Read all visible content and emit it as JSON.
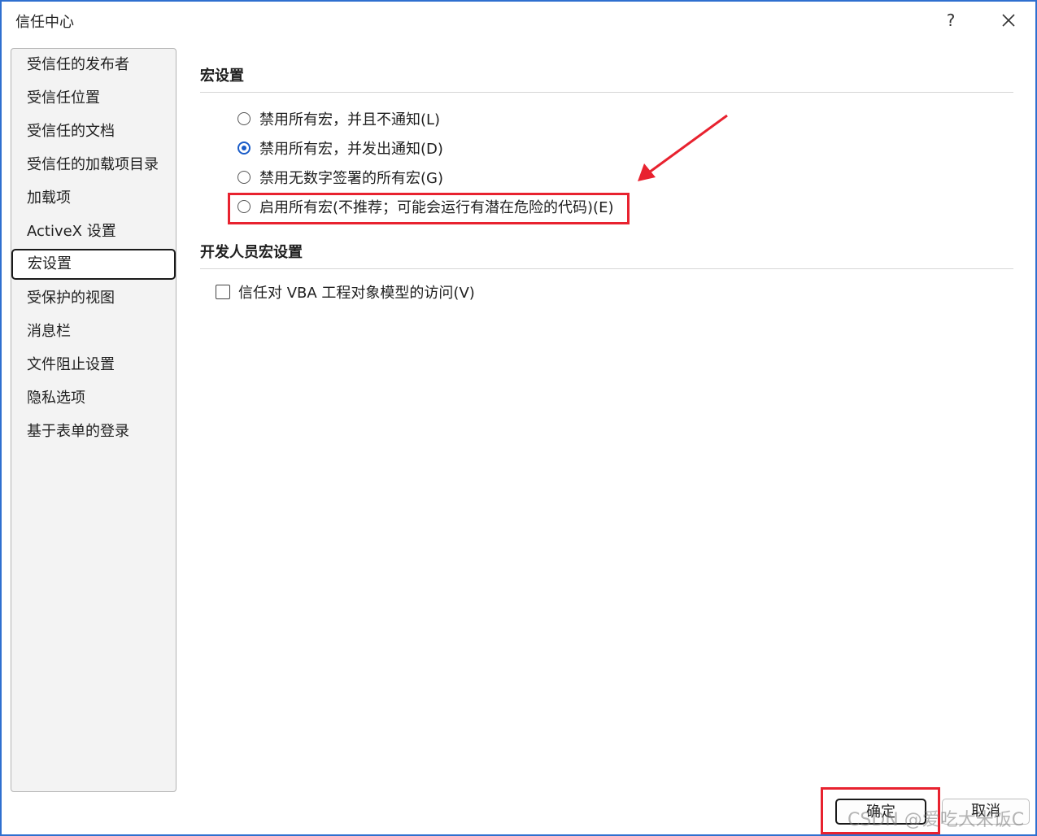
{
  "window": {
    "title": "信任中心",
    "help": "?"
  },
  "sidebar": {
    "items": [
      {
        "label": "受信任的发布者"
      },
      {
        "label": "受信任位置"
      },
      {
        "label": "受信任的文档"
      },
      {
        "label": "受信任的加载项目录"
      },
      {
        "label": "加载项"
      },
      {
        "label": "ActiveX 设置"
      },
      {
        "label": "宏设置",
        "selected": true
      },
      {
        "label": "受保护的视图"
      },
      {
        "label": "消息栏"
      },
      {
        "label": "文件阻止设置"
      },
      {
        "label": "隐私选项"
      },
      {
        "label": "基于表单的登录"
      }
    ]
  },
  "macro_settings": {
    "title": "宏设置",
    "options": [
      {
        "label": "禁用所有宏，并且不通知(L)",
        "checked": false
      },
      {
        "label": "禁用所有宏，并发出通知(D)",
        "checked": true
      },
      {
        "label": "禁用无数字签署的所有宏(G)",
        "checked": false
      },
      {
        "label": "启用所有宏(不推荐；可能会运行有潜在危险的代码)(E)",
        "checked": false
      }
    ]
  },
  "developer_settings": {
    "title": "开发人员宏设置",
    "vba_access": {
      "label": "信任对 VBA 工程对象模型的访问(V)",
      "checked": false
    }
  },
  "buttons": {
    "ok": "确定",
    "cancel": "取消"
  },
  "watermark": "CSDN @爱吃大米饭C",
  "colors": {
    "accent": "#1a5cc8",
    "annotation": "#e8222f",
    "border": "#2f6fcf"
  }
}
